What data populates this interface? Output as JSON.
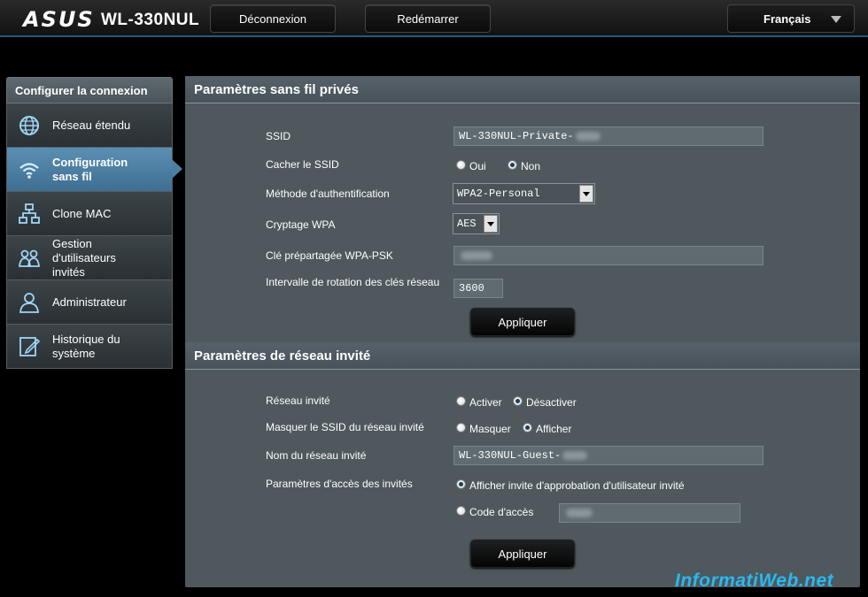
{
  "header": {
    "brand": "ASUS",
    "model": "WL-330NUL",
    "logout_label": "Déconnexion",
    "reboot_label": "Redémarrer",
    "language": "Français"
  },
  "sidebar": {
    "title": "Configurer la connexion",
    "items": [
      {
        "label": "Réseau étendu",
        "icon": "globe-icon"
      },
      {
        "label": "Configuration sans fil",
        "icon": "wifi-icon",
        "active": true
      },
      {
        "label": "Clone MAC",
        "icon": "network-icon"
      },
      {
        "label": "Gestion d'utilisateurs invités",
        "icon": "users-icon"
      },
      {
        "label": "Administrateur",
        "icon": "user-icon"
      },
      {
        "label": "Historique du système",
        "icon": "log-icon"
      }
    ]
  },
  "private": {
    "title": "Paramètres sans fil privés",
    "ssid_label": "SSID",
    "ssid_value": "WL-330NUL-Private-",
    "hide_ssid_label": "Cacher le SSID",
    "hide_yes": "Oui",
    "hide_no": "Non",
    "auth_label": "Méthode d'authentification",
    "auth_value": "WPA2-Personal",
    "wpa_enc_label": "Cryptage WPA",
    "wpa_enc_value": "AES",
    "psk_label": "Clé prépartagée WPA-PSK",
    "rotation_label": "Intervalle de rotation des clés réseau",
    "rotation_value": "3600",
    "apply_label": "Appliquer"
  },
  "guest": {
    "title": "Paramètres de réseau invité",
    "network_label": "Réseau invité",
    "enable": "Activer",
    "disable": "Désactiver",
    "mask_label": "Masquer le SSID du réseau invité",
    "mask": "Masquer",
    "show": "Afficher",
    "name_label": "Nom du réseau invité",
    "name_value": "WL-330NUL-Guest-",
    "access_label": "Paramètres d'accès des invités",
    "access_opt1": "Afficher invite d'approbation d'utilisateur invité",
    "access_opt2": "Code d'accès",
    "apply_label": "Appliquer"
  },
  "watermark": "InformatiWeb.net"
}
